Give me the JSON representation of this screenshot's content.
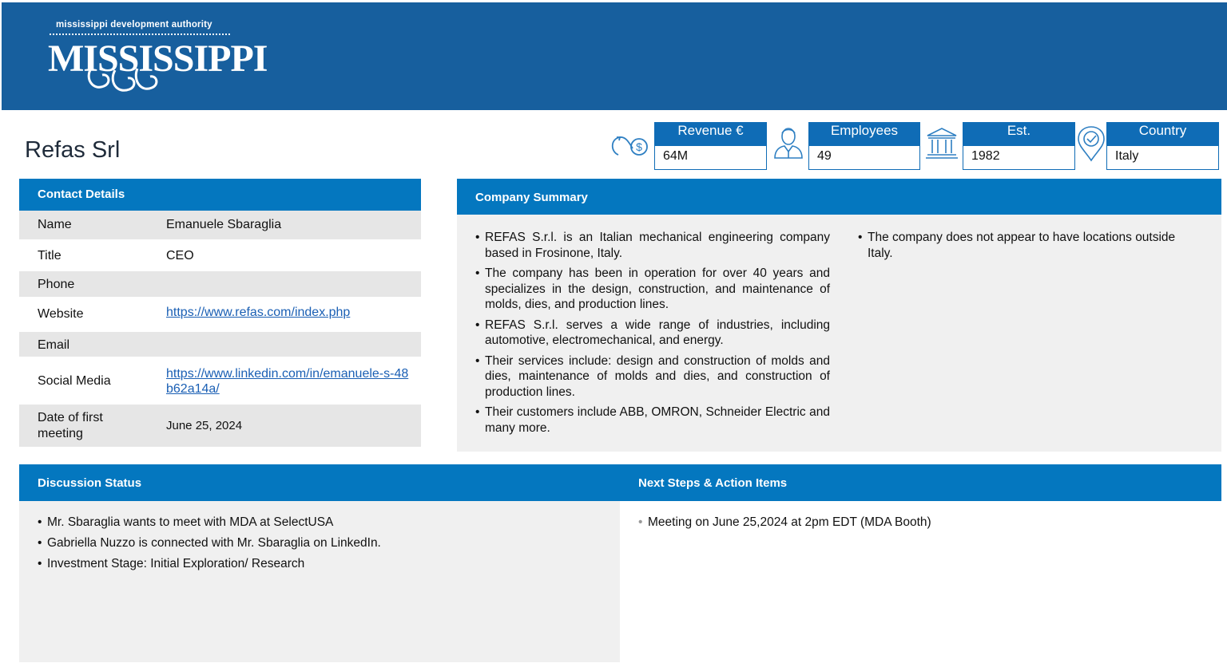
{
  "header": {
    "logo_small": "mississippi development authority",
    "logo_main": "MISSISSIPPI"
  },
  "company": {
    "name": "Refas Srl"
  },
  "stats": {
    "revenue": {
      "label": "Revenue €",
      "value": "64M",
      "icon": "revenue-cycle-icon"
    },
    "employees": {
      "label": "Employees",
      "value": "49",
      "icon": "person-icon"
    },
    "established": {
      "label": "Est.",
      "value": "1982",
      "icon": "institution-icon"
    },
    "country": {
      "label": "Country",
      "value": "Italy",
      "icon": "location-pin-icon"
    }
  },
  "contact": {
    "heading": "Contact Details",
    "rows": [
      {
        "label": "Name",
        "value": "Emanuele Sbaraglia"
      },
      {
        "label": "Title",
        "value": "CEO"
      },
      {
        "label": "Phone",
        "value": ""
      },
      {
        "label": "Website",
        "value": "https://www.refas.com/index.php"
      },
      {
        "label": "Email",
        "value": ""
      },
      {
        "label": "Social Media",
        "value": "https://www.linkedin.com/in/emanuele-s-48b62a14a/"
      },
      {
        "label": "Date of first meeting",
        "value": "June 25, 2024"
      }
    ]
  },
  "summary": {
    "heading": "Company Summary",
    "left": [
      "REFAS S.r.l. is an Italian mechanical engineering company based in Frosinone, Italy.",
      "The company has been in operation for over 40 years and specializes in the design, construction, and maintenance of molds, dies, and production lines.",
      "REFAS S.r.l. serves a wide range of industries, including automotive, electromechanical, and energy.",
      "Their services include: design and construction of molds and dies, maintenance of molds and dies, and construction of production lines.",
      "Their customers include ABB, OMRON, Schneider Electric and many more."
    ],
    "right": [
      "The company does not appear to have locations outside Italy."
    ]
  },
  "discussion": {
    "heading": "Discussion Status",
    "items": [
      "Mr. Sbaraglia wants to meet with MDA at SelectUSA",
      "Gabriella Nuzzo is connected with Mr. Sbaraglia on LinkedIn.",
      "Investment Stage: Initial Exploration/ Research"
    ]
  },
  "next_steps": {
    "heading": "Next Steps & Action Items",
    "items": [
      "Meeting on June 25,2024 at 2pm EDT (MDA Booth)"
    ]
  },
  "colors": {
    "header": "#175f9e",
    "panel_header": "#0477bf",
    "shade": "#e6e6e6",
    "panel_bg": "#f0f0f0"
  }
}
